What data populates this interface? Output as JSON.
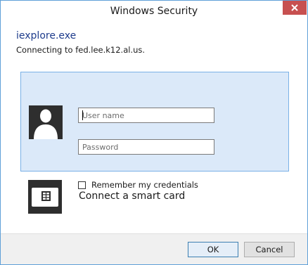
{
  "window": {
    "title": "Windows Security",
    "close_icon": "close-x-icon"
  },
  "header": {
    "app_name": "iexplore.exe",
    "connecting_text": "Connecting to fed.lee.k12.al.us."
  },
  "credentials": {
    "avatar_icon": "user-silhouette-icon",
    "username_placeholder": "User name",
    "username_value": "",
    "password_placeholder": "Password",
    "password_value": "",
    "remember_label": "Remember my credentials",
    "remember_checked": false
  },
  "smartcard": {
    "icon": "smart-card-icon",
    "label": "Connect a smart card"
  },
  "buttons": {
    "ok_label": "OK",
    "cancel_label": "Cancel"
  },
  "colors": {
    "accent_border": "#7ab1e6",
    "panel_bg": "#dbe9f9",
    "close_red": "#c75050",
    "app_name_blue": "#1e3c8c"
  }
}
